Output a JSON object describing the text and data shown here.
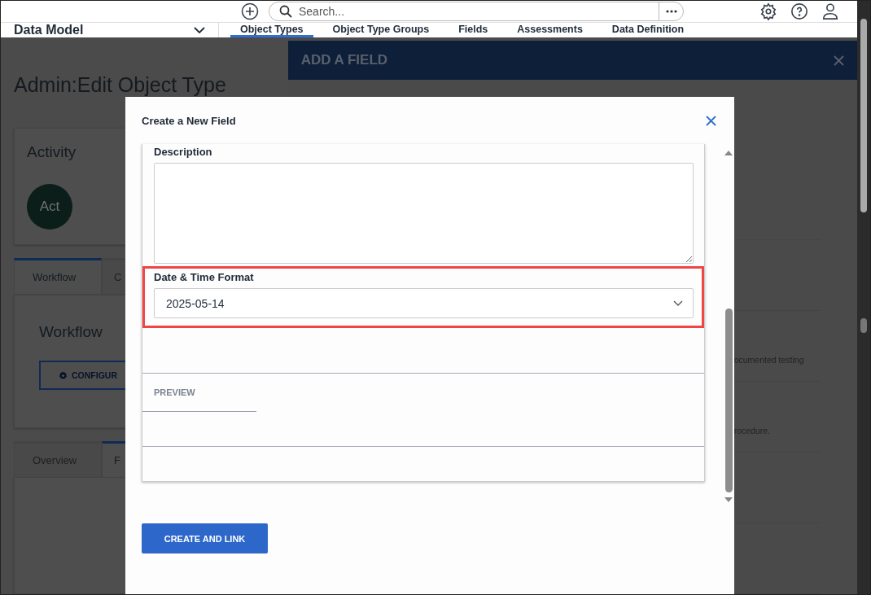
{
  "header": {
    "search": {
      "placeholder": "Search..."
    }
  },
  "nav": {
    "module": "Data Model",
    "tabs": [
      {
        "label": "Object Types",
        "selected": true
      },
      {
        "label": "Object Type Groups",
        "selected": false
      },
      {
        "label": "Fields",
        "selected": false
      },
      {
        "label": "Assessments",
        "selected": false
      },
      {
        "label": "Data Definition",
        "selected": false
      }
    ]
  },
  "page": {
    "title": "Admin:Edit Object Type",
    "activity": {
      "title": "Activity",
      "avatar": "Act"
    },
    "workflow_tabs": [
      {
        "label": "Workflow",
        "selected": true
      },
      {
        "label": "C",
        "selected": false
      }
    ],
    "workflow": {
      "title": "Workflow",
      "button": "CONFIGUR"
    },
    "detail_tabs": [
      {
        "label": "Overview",
        "selected": false
      },
      {
        "label": "F",
        "selected": true
      }
    ]
  },
  "drawer": {
    "title": "ADD A FIELD",
    "rows": [
      "",
      "",
      "ocumented testing",
      "rocedure.",
      "",
      ""
    ]
  },
  "modal": {
    "title": "Create a New Field",
    "description": {
      "label": "Description"
    },
    "date_format": {
      "label": "Date & Time Format",
      "value": "2025-05-14",
      "highlighted": true
    },
    "preview_tab": "PREVIEW",
    "button": "CREATE AND LINK"
  }
}
